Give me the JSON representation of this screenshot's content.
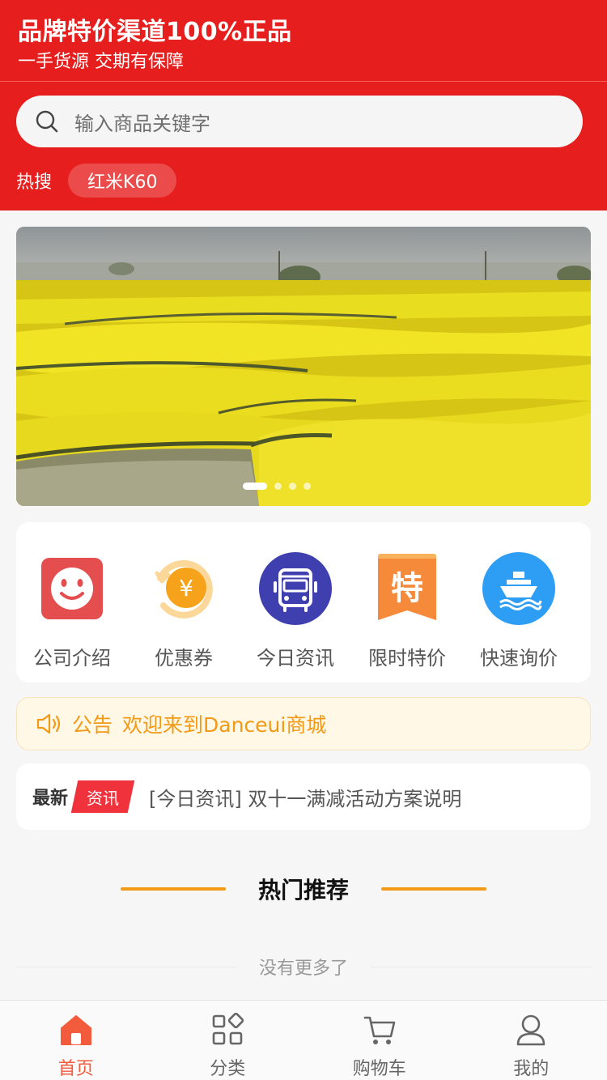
{
  "header": {
    "title": "品牌特价渠道100%正品",
    "subtitle": "一手货源 交期有保障",
    "bg_color": "#e61e1d"
  },
  "search": {
    "placeholder": "输入商品关键字",
    "icon": "search-icon"
  },
  "hot_search": {
    "label": "热搜",
    "items": [
      "红米K60"
    ]
  },
  "banner": {
    "subject": "rapeseed flower field photo",
    "slide_count": 4,
    "active_slide": 1
  },
  "quick_entries": [
    {
      "label": "公司介绍",
      "icon": "smiley-icon",
      "color": "#e54e4e"
    },
    {
      "label": "优惠券",
      "icon": "coupon-yen-icon",
      "color": "#f7a21b"
    },
    {
      "label": "今日资讯",
      "icon": "bus-icon",
      "color": "#3f3fb0"
    },
    {
      "label": "限时特价",
      "icon": "special-price-icon",
      "color": "#f58a3b"
    },
    {
      "label": "快速询价",
      "icon": "ship-icon",
      "color": "#2e9ef5"
    }
  ],
  "notice": {
    "icon": "speaker-icon",
    "tag": "公告",
    "text": "欢迎来到Danceui商城",
    "color": "#f29a16"
  },
  "news": {
    "latest_label": "最新",
    "badge": "资讯",
    "headline": "[今日资讯] 双十一满减活动方案说明"
  },
  "section": {
    "title": "热门推荐"
  },
  "list_end": "没有更多了",
  "tabbar": [
    {
      "label": "首页",
      "icon": "home-icon",
      "active": true
    },
    {
      "label": "分类",
      "icon": "category-icon",
      "active": false
    },
    {
      "label": "购物车",
      "icon": "cart-icon",
      "active": false
    },
    {
      "label": "我的",
      "icon": "user-icon",
      "active": false
    }
  ]
}
